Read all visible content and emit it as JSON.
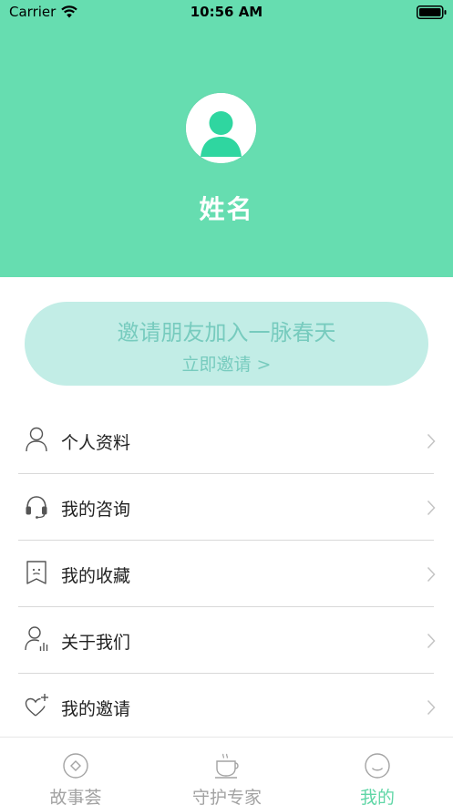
{
  "status_bar": {
    "carrier": "Carrier",
    "time": "10:56 AM"
  },
  "profile": {
    "name": "姓名",
    "avatar_icon": "user-avatar-icon"
  },
  "invite": {
    "title": "邀请朋友加入一脉春天",
    "action": "立即邀请 >"
  },
  "menu": {
    "items": [
      {
        "label": "个人资料",
        "icon": "person-icon"
      },
      {
        "label": "我的咨询",
        "icon": "headset-icon"
      },
      {
        "label": "我的收藏",
        "icon": "bookmark-icon"
      },
      {
        "label": "关于我们",
        "icon": "person-chart-icon"
      },
      {
        "label": "我的邀请",
        "icon": "heart-plus-icon"
      }
    ]
  },
  "tab_bar": {
    "tabs": [
      {
        "label": "故事荟",
        "icon": "diamond-circle-icon",
        "active": false
      },
      {
        "label": "守护专家",
        "icon": "coffee-cup-icon",
        "active": false
      },
      {
        "label": "我的",
        "icon": "smile-face-icon",
        "active": true
      }
    ]
  },
  "colors": {
    "header_bg": "#66ddb0",
    "invite_bg": "#c2ede6",
    "invite_text": "#77cbbe",
    "tab_active": "#5fd6a6",
    "tab_inactive": "#a3a3a3"
  }
}
